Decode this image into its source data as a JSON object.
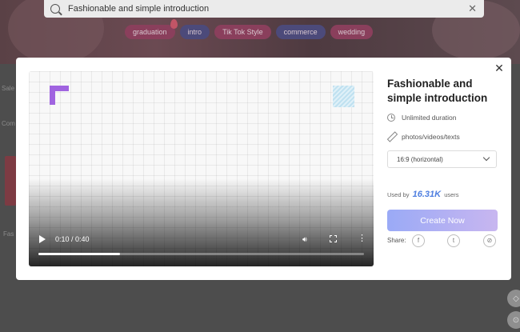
{
  "search": {
    "query": "Fashionable and simple introduction",
    "close_glyph": "✕"
  },
  "tags": [
    {
      "label": "graduation",
      "color": "pink"
    },
    {
      "label": "intro",
      "color": "blue"
    },
    {
      "label": "Tik Tok Style",
      "color": "pink"
    },
    {
      "label": "commerce",
      "color": "blue"
    },
    {
      "label": "wedding",
      "color": "pink"
    }
  ],
  "background": {
    "side_text_1": "Sale",
    "side_text_2": "Com",
    "side_text_3": "Fas"
  },
  "modal": {
    "close_glyph": "✕",
    "title": "Fashionable and simple introduction",
    "features": {
      "duration": "Unlimited duration",
      "media": "photos/videos/texts"
    },
    "aspect_select": {
      "selected": "16:9 (horizontal)"
    },
    "used_by": {
      "prefix": "Used by",
      "count": "16.31K",
      "suffix": "users"
    },
    "create_button": "Create Now",
    "share": {
      "label": "Share:",
      "icons": [
        "facebook-icon",
        "twitter-icon",
        "link-icon"
      ]
    },
    "video": {
      "time": "0:10 / 0:40",
      "progress": 0.25,
      "accent_color": "#a064e0"
    }
  }
}
